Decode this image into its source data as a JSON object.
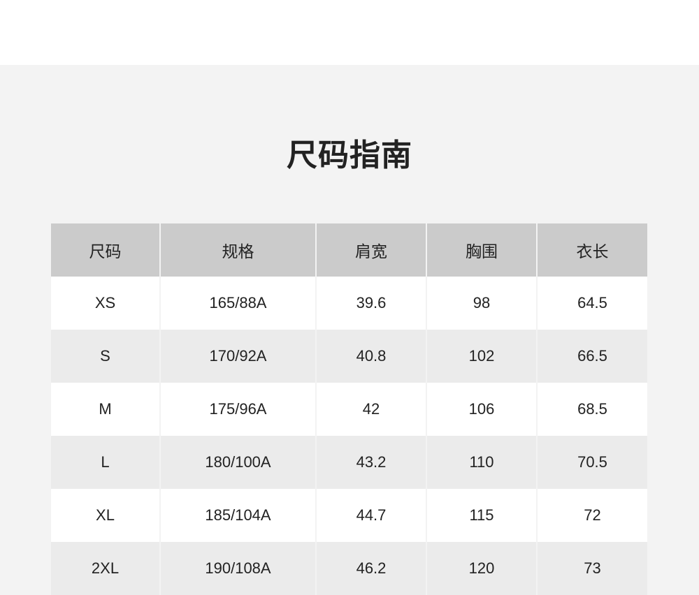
{
  "title": "尺码指南",
  "table": {
    "headers": [
      "尺码",
      "规格",
      "肩宽",
      "胸围",
      "衣长"
    ],
    "rows": [
      [
        "XS",
        "165/88A",
        "39.6",
        "98",
        "64.5"
      ],
      [
        "S",
        "170/92A",
        "40.8",
        "102",
        "66.5"
      ],
      [
        "M",
        "175/96A",
        "42",
        "106",
        "68.5"
      ],
      [
        "L",
        "180/100A",
        "43.2",
        "110",
        "70.5"
      ],
      [
        "XL",
        "185/104A",
        "44.7",
        "115",
        "72"
      ],
      [
        "2XL",
        "190/108A",
        "46.2",
        "120",
        "73"
      ]
    ]
  }
}
